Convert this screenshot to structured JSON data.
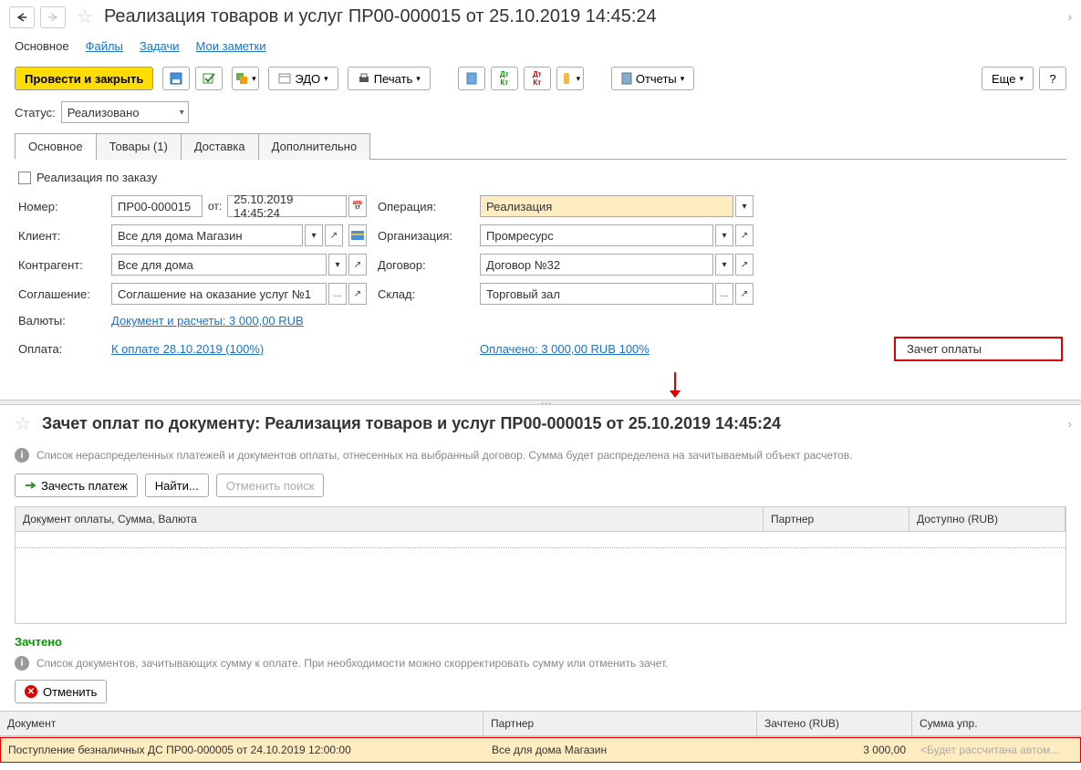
{
  "header": {
    "title": "Реализация товаров и услуг ПР00-000015 от 25.10.2019 14:45:24"
  },
  "nav": {
    "main": "Основное",
    "files": "Файлы",
    "tasks": "Задачи",
    "notes": "Мои заметки"
  },
  "toolbar": {
    "submit_close": "Провести и закрыть",
    "edo": "ЭДО",
    "print": "Печать",
    "reports": "Отчеты",
    "more": "Еще"
  },
  "status": {
    "label": "Статус:",
    "value": "Реализовано"
  },
  "tabs": {
    "main": "Основное",
    "goods": "Товары (1)",
    "delivery": "Доставка",
    "additional": "Дополнительно"
  },
  "form": {
    "by_order": "Реализация по заказу",
    "number_label": "Номер:",
    "number": "ПР00-000015",
    "from": "от:",
    "date": "25.10.2019 14:45:24",
    "operation_label": "Операция:",
    "operation": "Реализация",
    "client_label": "Клиент:",
    "client": "Все для дома Магазин",
    "org_label": "Организация:",
    "org": "Промресурс",
    "counterparty_label": "Контрагент:",
    "counterparty": "Все для дома",
    "contract_label": "Договор:",
    "contract": "Договор №32",
    "agreement_label": "Соглашение:",
    "agreement": "Соглашение на оказание услуг №1",
    "warehouse_label": "Склад:",
    "warehouse": "Торговый зал",
    "currency_label": "Валюты:",
    "currency_link": "Документ и расчеты: 3 000,00 RUB",
    "payment_label": "Оплата:",
    "payment_link": "К оплате 28.10.2019 (100%)",
    "paid_link": "Оплачено: 3 000,00 RUB  100%",
    "credit_btn": "Зачет оплаты"
  },
  "sub": {
    "title": "Зачет оплат по документу: Реализация товаров и услуг ПР00-000015 от 25.10.2019 14:45:24",
    "info1": "Список нераспределенных платежей и документов оплаты, отнесенных на выбранный договор. Сумма будет распределена на зачитываемый объект расчетов.",
    "credit_payment": "Зачесть платеж",
    "find": "Найти...",
    "cancel_search": "Отменить поиск",
    "col_doc": "Документ оплаты, Сумма, Валюта",
    "col_partner": "Партнер",
    "col_available": "Доступно (RUB)",
    "credited": "Зачтено",
    "info2": "Список документов, зачитывающих сумму к оплате. При необходимости можно скорректировать сумму или отменить зачет.",
    "cancel": "Отменить",
    "col2_doc": "Документ",
    "col2_partner": "Партнер",
    "col2_credited": "Зачтено (RUB)",
    "col2_sum": "Сумма упр.",
    "row_doc": "Поступление безналичных ДС ПР00-000005 от 24.10.2019 12:00:00",
    "row_partner": "Все для дома Магазин",
    "row_credited": "3 000,00",
    "row_sum": "<Будет рассчитана автом..."
  }
}
